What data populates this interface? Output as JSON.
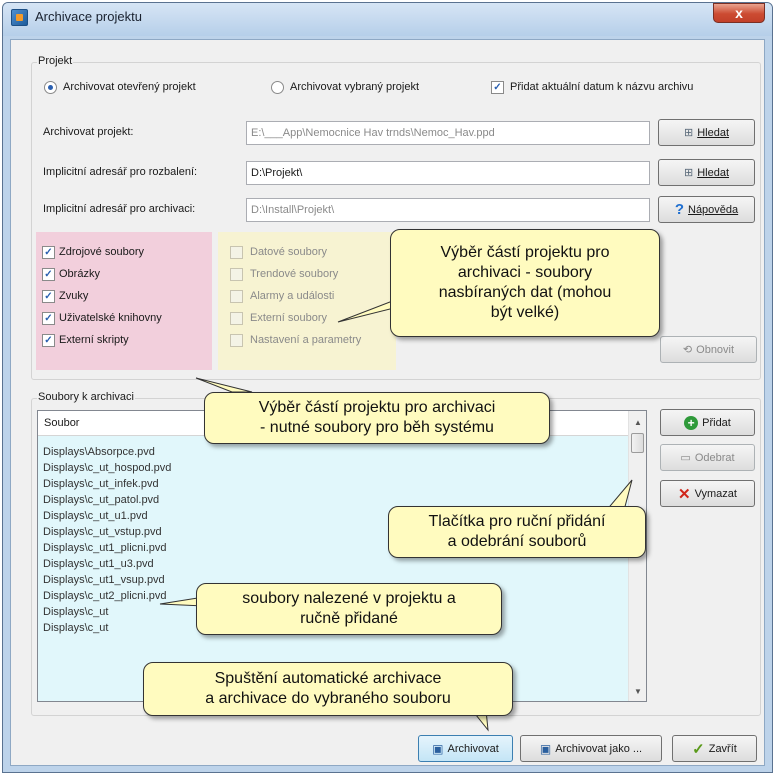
{
  "window": {
    "title": "Archivace projektu",
    "close_label": "x"
  },
  "projekt": {
    "group_label": "Projekt",
    "radio_open": "Archivovat otevřený projekt",
    "radio_selected": "Archivovat vybraný projekt",
    "check_date": "Přidat aktuální datum k názvu archivu",
    "rows": [
      {
        "label": "Archivovat projekt:",
        "value": "E:\\___App\\Nemocnice Hav trnds\\Nemoc_Hav.ppd",
        "button": "Hledat"
      },
      {
        "label": "Implicitní adresář pro rozbalení:",
        "value": "D:\\Projekt\\",
        "button": "Hledat"
      },
      {
        "label": "Implicitní adresář pro archivaci:",
        "value": "D:\\Install\\Projekt\\",
        "button": "Nápověda"
      }
    ]
  },
  "parts_required": [
    "Zdrojové soubory",
    "Obrázky",
    "Zvuky",
    "Uživatelské knihovny",
    "Externí skripty"
  ],
  "parts_optional": [
    "Datové soubory",
    "Trendové soubory",
    "Alarmy a události",
    "Externí soubory",
    "Nastavení a parametry"
  ],
  "refresh_button": "Obnovit",
  "files": {
    "group_label": "Soubory k archivaci",
    "column_header": "Soubor",
    "rows": [
      "Displays\\Absorpce.pvd",
      "Displays\\c_ut_hospod.pvd",
      "Displays\\c_ut_infek.pvd",
      "Displays\\c_ut_patol.pvd",
      "Displays\\c_ut_u1.pvd",
      "Displays\\c_ut_vstup.pvd",
      "Displays\\c_ut1_plicni.pvd",
      "Displays\\c_ut1_u3.pvd",
      "Displays\\c_ut1_vsup.pvd",
      "Displays\\c_ut2_plicni.pvd",
      "Displays\\c_ut",
      "Displays\\c_ut"
    ],
    "add_button": "Přidat",
    "remove_button": "Odebrat",
    "delete_button": "Vymazat"
  },
  "footer": {
    "archive_button": "Archivovat",
    "archive_as_button": "Archivovat jako ...",
    "close_button": "Zavřít"
  },
  "callouts": {
    "optional_parts": [
      "Výběr částí projektu pro",
      "archivaci - soubory",
      "nasbíraných dat (mohou",
      "být velké)"
    ],
    "required_parts": [
      "Výběr částí projektu pro archivaci",
      "- nutné soubory pro běh systému"
    ],
    "buttons": [
      "Tlačítka pro ruční přidání",
      "a odebrání souborů"
    ],
    "files_found": [
      "soubory nalezené v projektu a",
      "ručně přidané"
    ],
    "archive": [
      "Spuštění automatické archivace",
      "a archivace do vybraného souboru"
    ]
  },
  "colors": {
    "required_bg": "#f2cfdc",
    "optional_bg": "#f7f3d2",
    "list_bg": "#e1f7fb",
    "callout_bg": "#fffbbf"
  }
}
